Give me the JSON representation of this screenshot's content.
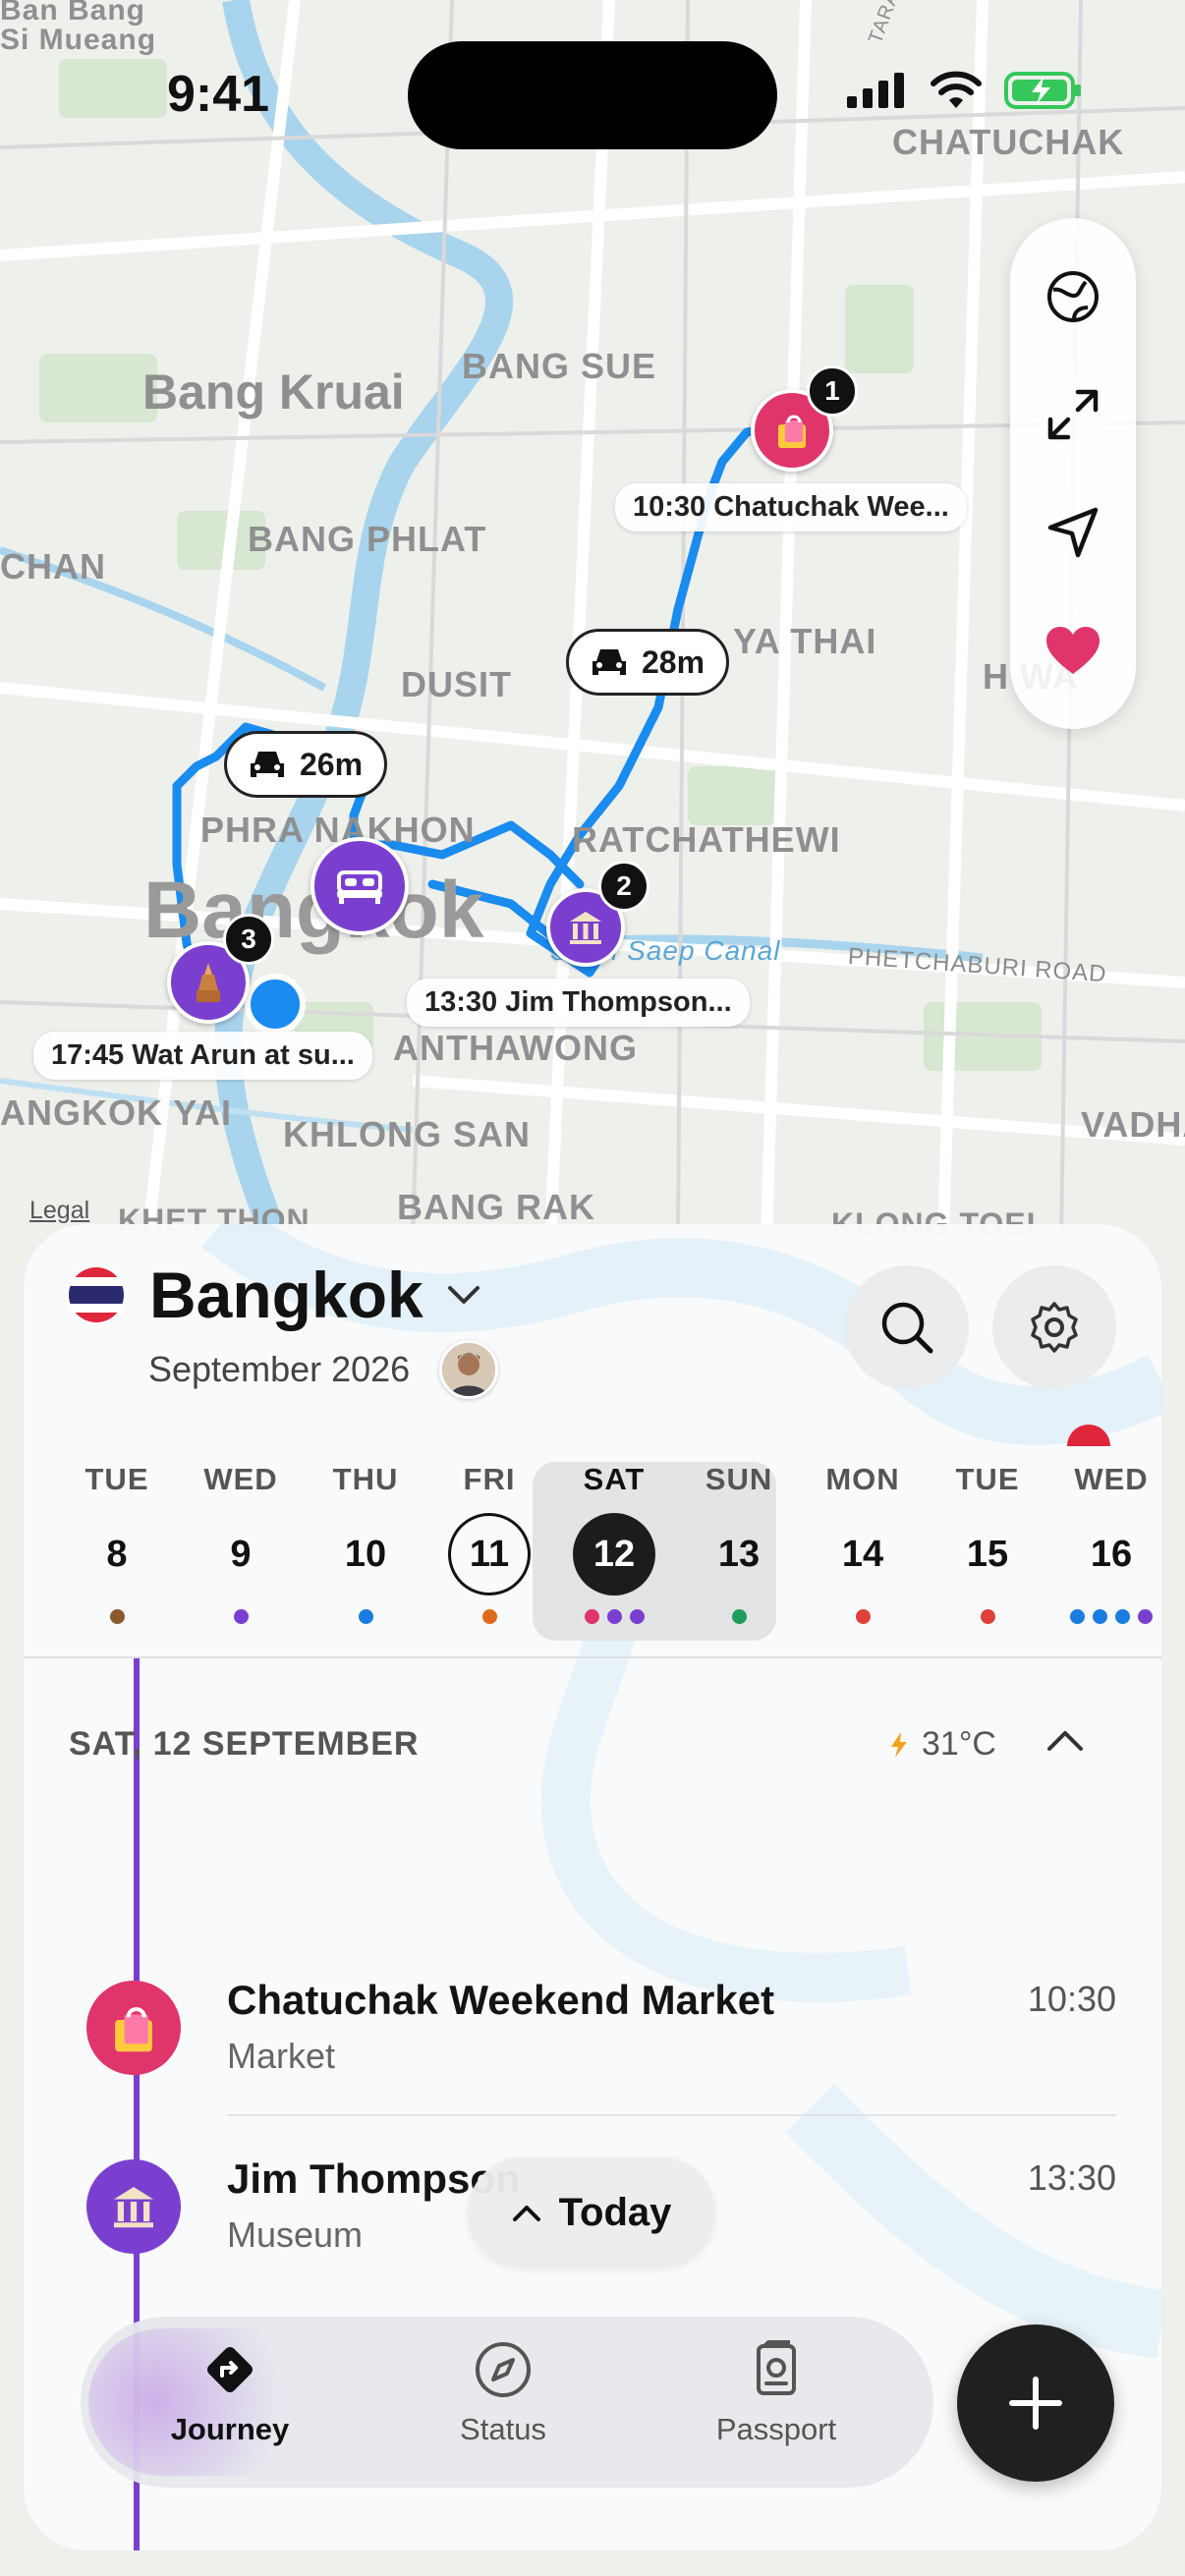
{
  "status_bar": {
    "time": "9:41"
  },
  "map": {
    "labels": {
      "ban_bang": "Ban Bang",
      "si_mueang": "Si Mueang",
      "chatuchak": "CHATUCHAK",
      "bang_kruai": "Bang Kruai",
      "bang_sue": "BANG SUE",
      "bang_phlat": "BANG PHLAT",
      "chan": "CHAN",
      "dusit": "DUSIT",
      "phaya_thai": "YA THAI",
      "hu_wang": "H       WA",
      "phra_nakhon": "PHRA NAKHON",
      "ratchathewi": "RATCHATHEWI",
      "bangkok": "Bangkok",
      "saen_saep": "Saen Saep Canal",
      "phetchaburi": "PHETCHABURI ROAD",
      "samphanthawong": "ANTHAWONG",
      "bangkok_yai": "ANGKOK YAI",
      "khlong_san": "KHLONG SAN",
      "vadhana": "VADHA",
      "bang_rak": "BANG RAK",
      "khet_thon": "KHET THON",
      "khlong_toei": "KLONG TOEI",
      "tarap": "TARAP"
    },
    "callouts": {
      "stop1": "10:30 Chatuchak Wee...",
      "stop2": "13:30 Jim Thompson...",
      "stop3": "17:45 Wat Arun at su..."
    },
    "drives": {
      "north": "28m",
      "west": "26m"
    },
    "badges": {
      "one": "1",
      "two": "2",
      "three": "3"
    },
    "legal": "Legal"
  },
  "sheet": {
    "city": "Bangkok",
    "month": "September 2026",
    "days": [
      {
        "name": "TUE",
        "num": "8"
      },
      {
        "name": "WED",
        "num": "9"
      },
      {
        "name": "THU",
        "num": "10"
      },
      {
        "name": "FRI",
        "num": "11"
      },
      {
        "name": "SAT",
        "num": "12"
      },
      {
        "name": "SUN",
        "num": "13"
      },
      {
        "name": "MON",
        "num": "14"
      },
      {
        "name": "TUE",
        "num": "15"
      },
      {
        "name": "WED",
        "num": "16"
      }
    ],
    "day_heading": "SAT, 12 SEPTEMBER",
    "weather": "31°C",
    "entries": [
      {
        "name": "Chatuchak Weekend Market",
        "type": "Market",
        "time": "10:30"
      },
      {
        "name": "Jim Thompson",
        "type": "Museum",
        "time": "13:30"
      }
    ],
    "today_button": "Today",
    "tabs": {
      "journey": "Journey",
      "status": "Status",
      "passport": "Passport"
    }
  },
  "colors": {
    "route": "#1a8bef",
    "market": "#e0356a",
    "museum": "#7b3fd0",
    "accent_purple": "#7a3fd0"
  }
}
